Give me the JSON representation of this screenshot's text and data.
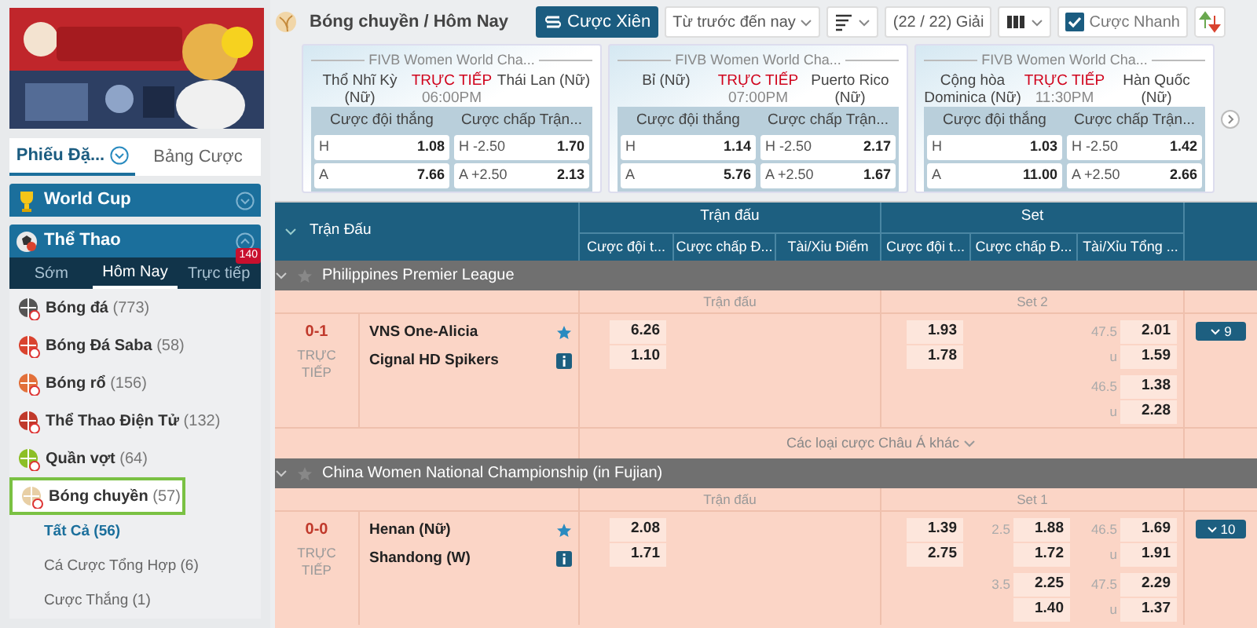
{
  "sidebar": {
    "tabs": [
      {
        "label": "Phiếu Đặ...",
        "selected": true
      },
      {
        "label": "Bảng Cược",
        "selected": false
      }
    ],
    "sections": [
      {
        "label": "World Cup",
        "expanded": false
      },
      {
        "label": "Thể Thao",
        "expanded": true
      }
    ],
    "period_tabs": [
      {
        "label": "Sớm",
        "selected": false
      },
      {
        "label": "Hôm Nay",
        "selected": true
      },
      {
        "label": "Trực tiếp",
        "selected": false,
        "badge": "140"
      }
    ],
    "sports": [
      {
        "name": "Bóng đá",
        "count": "(773)",
        "selected": false
      },
      {
        "name": "Bóng Đá Saba",
        "count": "(58)",
        "selected": false
      },
      {
        "name": "Bóng rổ",
        "count": "(156)",
        "selected": false
      },
      {
        "name": "Thể Thao Điện Tử",
        "count": "(132)",
        "selected": false
      },
      {
        "name": "Quần vợt",
        "count": "(64)",
        "selected": false
      },
      {
        "name": "Bóng chuyền",
        "count": "(57)",
        "selected": true
      }
    ],
    "sub_items": [
      {
        "name": "Tất Cả",
        "count": "(56)",
        "selected": true
      },
      {
        "name": "Cá Cược Tổng Hợp",
        "count": "(6)",
        "selected": false
      },
      {
        "name": "Cược Thắng",
        "count": "(1)",
        "selected": false
      }
    ]
  },
  "toolbar": {
    "title": "Bóng chuyền / Hôm Nay",
    "parlay_button": "Cược Xiên",
    "date_filter": "Từ trước đến nay",
    "leagues": "(22 / 22) Giải",
    "quick_bet": {
      "label": "Cược Nhanh",
      "checked": true
    }
  },
  "featured": [
    {
      "league": "FIVB Women World Cha...",
      "home": "Thổ Nhĩ Kỳ (Nữ)",
      "away": "Thái Lan (Nữ)",
      "status": "TRỰC TIẾP",
      "time": "06:00PM",
      "markets": [
        {
          "title": "Cược đội thắng",
          "rows": [
            {
              "label": "H",
              "odds": "1.08"
            },
            {
              "label": "A",
              "odds": "7.66"
            }
          ]
        },
        {
          "title": "Cược chấp Trận...",
          "rows": [
            {
              "label": "H -2.50",
              "odds": "1.70"
            },
            {
              "label": "A +2.50",
              "odds": "2.13"
            }
          ]
        }
      ]
    },
    {
      "league": "FIVB Women World Cha...",
      "home": "Bỉ (Nữ)",
      "away": "Puerto Rico (Nữ)",
      "status": "TRỰC TIẾP",
      "time": "07:00PM",
      "markets": [
        {
          "title": "Cược đội thắng",
          "rows": [
            {
              "label": "H",
              "odds": "1.14"
            },
            {
              "label": "A",
              "odds": "5.76"
            }
          ]
        },
        {
          "title": "Cược chấp Trận...",
          "rows": [
            {
              "label": "H -2.50",
              "odds": "2.17"
            },
            {
              "label": "A +2.50",
              "odds": "1.67"
            }
          ]
        }
      ]
    },
    {
      "league": "FIVB Women World Cha...",
      "home": "Cộng hòa Dominica (Nữ)",
      "away": "Hàn Quốc (Nữ)",
      "status": "TRỰC TIẾP",
      "time": "11:30PM",
      "markets": [
        {
          "title": "Cược đội thắng",
          "rows": [
            {
              "label": "H",
              "odds": "1.03"
            },
            {
              "label": "A",
              "odds": "11.00"
            }
          ]
        },
        {
          "title": "Cược chấp Trận...",
          "rows": [
            {
              "label": "H -2.50",
              "odds": "1.42"
            },
            {
              "label": "A +2.50",
              "odds": "2.66"
            }
          ]
        }
      ]
    }
  ],
  "table": {
    "first_column": "Trận Đấu",
    "groups": [
      "Trận đấu",
      "Set"
    ],
    "columns": [
      "Cược đội t...",
      "Cược chấp Đ...",
      "Tài/Xỉu Điểm",
      "Cược đội t...",
      "Cược chấp Đ...",
      "Tài/Xỉu Tổng ..."
    ],
    "leagues": [
      {
        "name": "Philippines Premier League",
        "sections": [
          "Trận đấu",
          "Set 2"
        ],
        "footer": "Các loại cược Châu Á khác",
        "matches": [
          {
            "score": "0-1",
            "status": "TRỰC TIẾP",
            "teams": [
              "VNS One-Alicia",
              "Cignal HD Spikers"
            ],
            "more": "9",
            "markets": [
              {
                "kind": "match_winner",
                "blocks": [
                  [
                    {
                      "odds": "6.26"
                    },
                    {
                      "odds": "1.10"
                    }
                  ]
                ]
              },
              {
                "kind": "set_winner",
                "blocks": [
                  [
                    {
                      "odds": "1.93"
                    },
                    {
                      "odds": "1.78"
                    }
                  ]
                ]
              },
              {
                "kind": "set_total",
                "blocks": [
                  [
                    {
                      "label": "47.5",
                      "odds": "2.01"
                    },
                    {
                      "label": "u",
                      "odds": "1.59"
                    }
                  ],
                  [
                    {
                      "label": "46.5",
                      "odds": "1.38"
                    },
                    {
                      "label": "u",
                      "odds": "2.28"
                    }
                  ]
                ]
              }
            ]
          }
        ]
      },
      {
        "name": "China Women National Championship (in Fujian)",
        "sections": [
          "Trận đấu",
          "Set 1"
        ],
        "matches": [
          {
            "score": "0-0",
            "status": "TRỰC TIẾP",
            "teams": [
              "Henan (Nữ)",
              "Shandong (W)"
            ],
            "more": "10",
            "markets": [
              {
                "kind": "match_winner",
                "blocks": [
                  [
                    {
                      "odds": "2.08"
                    },
                    {
                      "odds": "1.71"
                    }
                  ]
                ]
              },
              {
                "kind": "set_winner",
                "blocks": [
                  [
                    {
                      "odds": "1.39"
                    },
                    {
                      "odds": "2.75"
                    }
                  ]
                ]
              },
              {
                "kind": "set_handicap",
                "blocks": [
                  [
                    {
                      "label": "2.5",
                      "odds": "1.88"
                    },
                    {
                      "odds": "1.72"
                    }
                  ],
                  [
                    {
                      "label": "3.5",
                      "odds": "2.25"
                    },
                    {
                      "odds": "1.40"
                    }
                  ]
                ]
              },
              {
                "kind": "set_total",
                "blocks": [
                  [
                    {
                      "label": "46.5",
                      "odds": "1.69"
                    },
                    {
                      "label": "u",
                      "odds": "1.91"
                    }
                  ],
                  [
                    {
                      "label": "47.5",
                      "odds": "2.29"
                    },
                    {
                      "label": "u",
                      "odds": "1.37"
                    }
                  ]
                ]
              }
            ]
          }
        ]
      }
    ]
  }
}
